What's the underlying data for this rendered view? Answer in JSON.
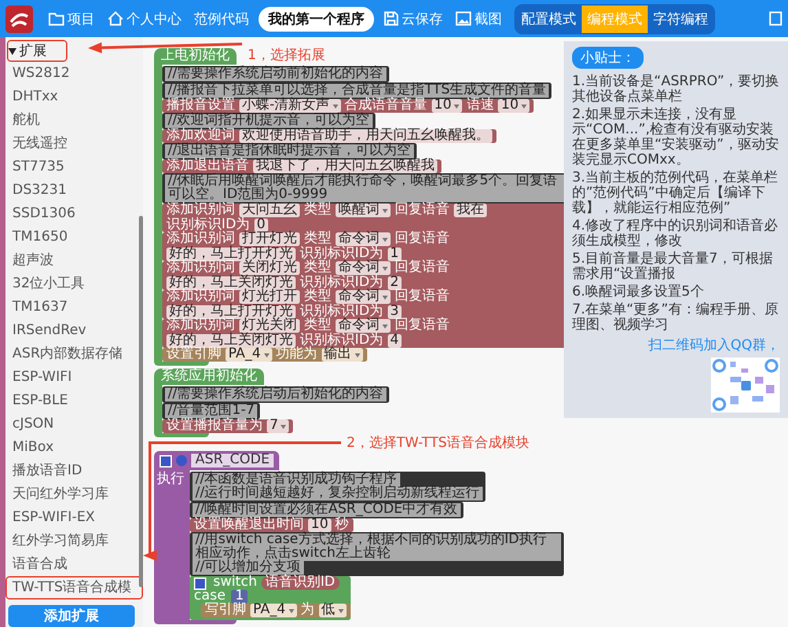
{
  "toolbar": {
    "items": [
      {
        "kind": "folder",
        "label": "项目"
      },
      {
        "kind": "home",
        "label": "个人中心"
      },
      {
        "kind": "plain",
        "label": "范例代码"
      },
      {
        "kind": "project",
        "label": "我的第一个程序"
      },
      {
        "kind": "save",
        "label": "云保存"
      },
      {
        "kind": "image",
        "label": "截图"
      }
    ],
    "modes": [
      {
        "label": "配置模式",
        "selected": false
      },
      {
        "label": "编程模式",
        "selected": true
      },
      {
        "label": "字符编程",
        "selected": false
      }
    ]
  },
  "sidebar": {
    "category": {
      "label": "扩展",
      "expanded": true,
      "highlighted": true,
      "children": [
        {
          "label": "WS2812",
          "highlighted": false
        },
        {
          "label": "DHTxx",
          "highlighted": false
        },
        {
          "label": "舵机",
          "highlighted": false
        },
        {
          "label": "无线遥控",
          "highlighted": false
        },
        {
          "label": "ST7735",
          "highlighted": false
        },
        {
          "label": "DS3231",
          "highlighted": false
        },
        {
          "label": "SSD1306",
          "highlighted": false
        },
        {
          "label": "TM1650",
          "highlighted": false
        },
        {
          "label": "超声波",
          "highlighted": false
        },
        {
          "label": "32位小工具",
          "highlighted": false
        },
        {
          "label": "TM1637",
          "highlighted": false
        },
        {
          "label": "IRSendRev",
          "highlighted": false
        },
        {
          "label": "ASR内部数据存储",
          "highlighted": false
        },
        {
          "label": "ESP-WIFI",
          "highlighted": false
        },
        {
          "label": "ESP-BLE",
          "highlighted": false
        },
        {
          "label": "cJSON",
          "highlighted": false
        },
        {
          "label": "MiBox",
          "highlighted": false
        },
        {
          "label": "播放语音ID",
          "highlighted": false
        },
        {
          "label": "天问红外学习库",
          "highlighted": false
        },
        {
          "label": "ESP-WIFI-EX",
          "highlighted": false
        },
        {
          "label": "红外学习简易库",
          "highlighted": false
        },
        {
          "label": "语音合成",
          "highlighted": false
        },
        {
          "label": "TW-TTS语音合成模",
          "highlighted": true
        }
      ]
    },
    "add_button": "添加扩展"
  },
  "workspace": {
    "sections": [
      {
        "kind": "hat",
        "title": "上电初始化",
        "blocks": [
          {
            "kind": "comment",
            "lines": [
              "//需要操作系统启动前初始化的内容"
            ]
          },
          {
            "kind": "comment",
            "lines": [
              "//播报音下拉菜单可以选择，合成音量是指TTS生成文件的音量"
            ]
          },
          {
            "kind": "speech",
            "parts": [
              {
                "kind": "label",
                "text": "播报音设置"
              },
              {
                "kind": "dropdown",
                "text": "小蝶-清新女声"
              },
              {
                "kind": "label",
                "text": "合成语音音量"
              },
              {
                "kind": "dropdown",
                "text": "10"
              },
              {
                "kind": "label",
                "text": "语速"
              },
              {
                "kind": "dropdown",
                "text": "10"
              }
            ]
          },
          {
            "kind": "comment",
            "lines": [
              "//欢迎词指开机提示音，可以为空"
            ]
          },
          {
            "kind": "speech",
            "parts": [
              {
                "kind": "label",
                "text": "添加欢迎词"
              },
              {
                "kind": "input",
                "text": "欢迎使用语音助手，用天问五幺唤醒我。"
              }
            ]
          },
          {
            "kind": "comment",
            "lines": [
              "//退出语音是指休眠时提示音，可以为空"
            ]
          },
          {
            "kind": "speech",
            "parts": [
              {
                "kind": "label",
                "text": "添加退出语音"
              },
              {
                "kind": "input",
                "text": "我退下了，用天问五幺唤醒我"
              }
            ]
          },
          {
            "kind": "comment",
            "lines": [
              "//休眠后用唤醒词唤醒后才能执行命令，唤醒词最多5个。回复语可以空。ID范围为0-9999"
            ]
          },
          {
            "kind": "speech",
            "parts": [
              {
                "kind": "label",
                "text": "添加识别词"
              },
              {
                "kind": "input",
                "text": "天问五幺"
              },
              {
                "kind": "label",
                "text": "类型"
              },
              {
                "kind": "dropdown",
                "text": "唤醒词"
              },
              {
                "kind": "label",
                "text": "回复语音"
              },
              {
                "kind": "input",
                "text": "我在"
              },
              {
                "kind": "label",
                "text": "识别标识ID为"
              },
              {
                "kind": "input",
                "text": "0"
              }
            ]
          },
          {
            "kind": "speech",
            "parts": [
              {
                "kind": "label",
                "text": "添加识别词"
              },
              {
                "kind": "input",
                "text": "打开灯光"
              },
              {
                "kind": "label",
                "text": "类型"
              },
              {
                "kind": "dropdown",
                "text": "命令词"
              },
              {
                "kind": "label",
                "text": "回复语音"
              },
              {
                "kind": "input",
                "text": "好的，马上打开灯光"
              },
              {
                "kind": "label",
                "text": "识别标识ID为"
              },
              {
                "kind": "input",
                "text": "1"
              }
            ]
          },
          {
            "kind": "speech",
            "parts": [
              {
                "kind": "label",
                "text": "添加识别词"
              },
              {
                "kind": "input",
                "text": "关闭灯光"
              },
              {
                "kind": "label",
                "text": "类型"
              },
              {
                "kind": "dropdown",
                "text": "命令词"
              },
              {
                "kind": "label",
                "text": "回复语音"
              },
              {
                "kind": "input",
                "text": "好的，马上关闭灯光"
              },
              {
                "kind": "label",
                "text": "识别标识ID为"
              },
              {
                "kind": "input",
                "text": "2"
              }
            ]
          },
          {
            "kind": "speech",
            "parts": [
              {
                "kind": "label",
                "text": "添加识别词"
              },
              {
                "kind": "input",
                "text": "灯光打开"
              },
              {
                "kind": "label",
                "text": "类型"
              },
              {
                "kind": "dropdown",
                "text": "命令词"
              },
              {
                "kind": "label",
                "text": "回复语音"
              },
              {
                "kind": "input",
                "text": "好的，马上打开灯光"
              },
              {
                "kind": "label",
                "text": "识别标识ID为"
              },
              {
                "kind": "input",
                "text": "3"
              }
            ]
          },
          {
            "kind": "speech",
            "parts": [
              {
                "kind": "label",
                "text": "添加识别词"
              },
              {
                "kind": "input",
                "text": "灯光关闭"
              },
              {
                "kind": "label",
                "text": "类型"
              },
              {
                "kind": "dropdown",
                "text": "命令词"
              },
              {
                "kind": "label",
                "text": "回复语音"
              },
              {
                "kind": "input",
                "text": "好的，马上关闭灯光"
              },
              {
                "kind": "label",
                "text": "识别标识ID为"
              },
              {
                "kind": "input",
                "text": "4"
              }
            ]
          },
          {
            "kind": "pin",
            "parts": [
              {
                "kind": "label",
                "text": "设置引脚"
              },
              {
                "kind": "dropdown",
                "text": "PA_4"
              },
              {
                "kind": "label",
                "text": "功能为"
              },
              {
                "kind": "dropdown",
                "text": "输出"
              }
            ]
          }
        ]
      },
      {
        "kind": "hat",
        "title": "系统应用初始化",
        "blocks": [
          {
            "kind": "comment",
            "lines": [
              "//需要操作系统启动后初始化的内容"
            ]
          },
          {
            "kind": "comment",
            "lines": [
              "//音量范围1-7"
            ]
          },
          {
            "kind": "speech",
            "parts": [
              {
                "kind": "label",
                "text": "设置播报音量为"
              },
              {
                "kind": "dropdown",
                "text": "7"
              }
            ]
          }
        ]
      },
      {
        "kind": "function",
        "name": "ASR_CODE",
        "label": "执行",
        "blocks": [
          {
            "kind": "comment",
            "lines": [
              "//本函数是语音识别成功钩子程序",
              "//运行时间越短越好，复杂控制启动新线程运行"
            ]
          },
          {
            "kind": "comment",
            "lines": [
              "//唤醒时间设置必须在ASR_CODE中才有效"
            ]
          },
          {
            "kind": "speech",
            "parts": [
              {
                "kind": "label",
                "text": "设置唤醒退出时间"
              },
              {
                "kind": "input",
                "text": "10"
              },
              {
                "kind": "label",
                "text": "秒"
              }
            ]
          },
          {
            "kind": "comment",
            "lines": [
              "//用switch case方式选择，根据不同的识别成功的ID执行相应动作，点击switch左上齿轮",
              "//可以增加分支项"
            ]
          },
          {
            "kind": "switch",
            "parts": [
              {
                "kind": "label",
                "text": "switch"
              },
              {
                "kind": "reporter",
                "text": "语音识别ID"
              }
            ],
            "cases": [
              {
                "label": "case",
                "value": "1",
                "blocks": [
                  {
                    "kind": "pin",
                    "parts": [
                      {
                        "kind": "label",
                        "text": "写引脚"
                      },
                      {
                        "kind": "dropdown",
                        "text": "PA_4"
                      },
                      {
                        "kind": "label",
                        "text": "为"
                      },
                      {
                        "kind": "dropdown",
                        "text": "低"
                      }
                    ]
                  }
                ]
              }
            ]
          }
        ]
      }
    ]
  },
  "tips": {
    "title": "小贴士：",
    "items": [
      "1.当前设备是“ASRPRO”，要切换其他设备点菜单栏",
      "2.如果显示未连接，没有显示“COM...”,检查有没有驱动安装在更多菜单里“安装驱动”，驱动安装完显示COMxx。",
      "3.当前主板的范例代码，在菜单栏的”范例代码”中确定后【编译下载】，就能运行相应范例”",
      "4.修改了程序中的识别词和语音必须生成模型，修改",
      "5.目前音量是最大音量7，可根据需求用“设置播报",
      "6.唤醒词最多设置5个",
      "7.在菜单“更多”有：编程手册、原理图、视频学习"
    ],
    "qr_caption": "扫二维码加入QQ群，"
  },
  "annotations": [
    {
      "text": "1，选择拓展"
    },
    {
      "text": "2，选择TW-TTS语音合成模块"
    }
  ]
}
